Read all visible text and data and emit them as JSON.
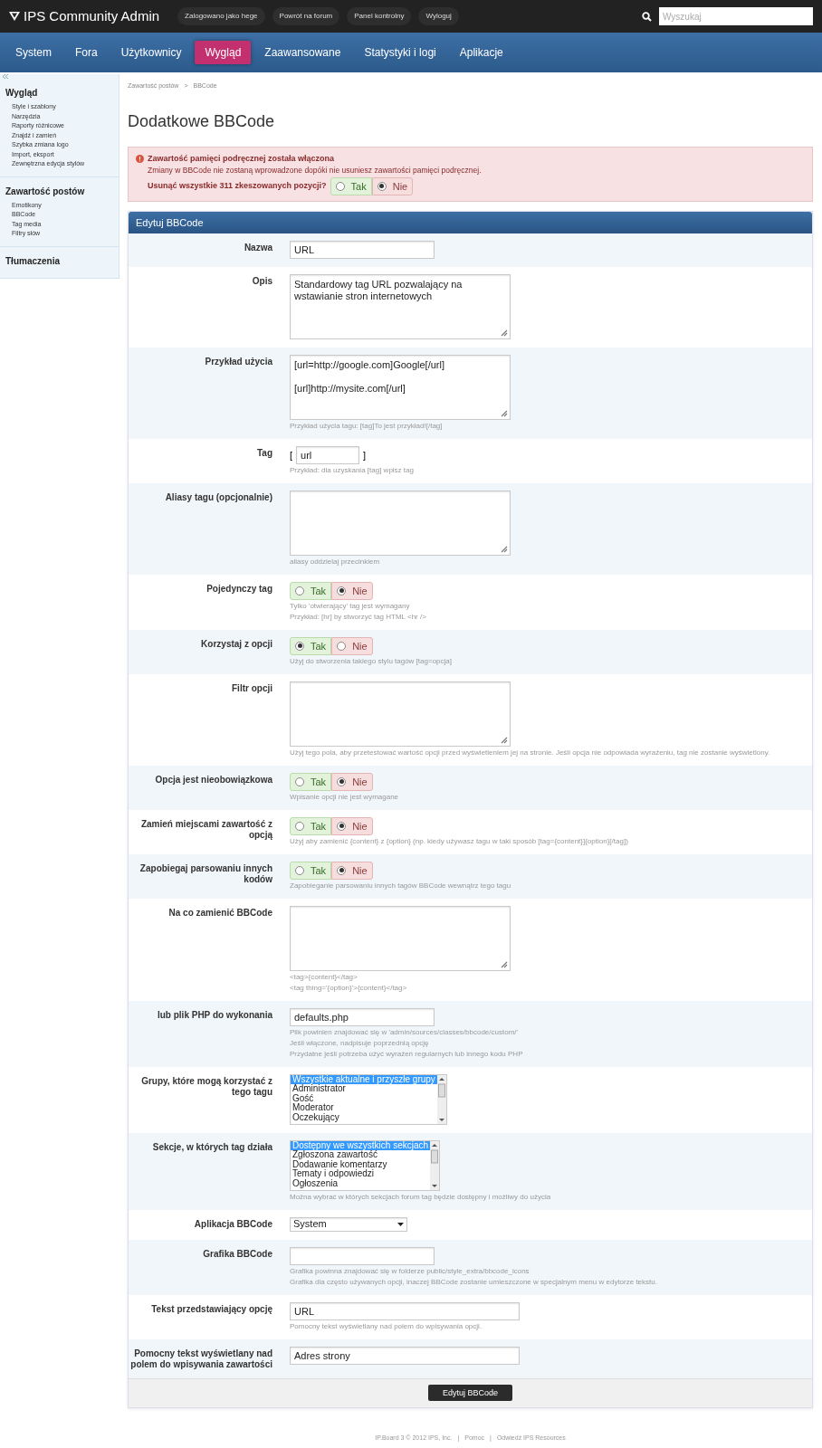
{
  "top_bar": {
    "logo": "IPS Community Admin",
    "links": [
      "Zalogowano jako hege",
      "Powrót na forum",
      "Panel kontrolny",
      "Wyloguj"
    ],
    "search": {
      "placeholder": "Wyszukaj"
    }
  },
  "nav": [
    {
      "label": "System",
      "selected": false
    },
    {
      "label": "Fora",
      "selected": false
    },
    {
      "label": "Użytkownicy",
      "selected": false
    },
    {
      "label": "Wygląd",
      "selected": true
    },
    {
      "label": "Zaawansowane",
      "selected": false
    },
    {
      "label": "Statystyki i logi",
      "selected": false
    },
    {
      "label": "Aplikacje",
      "selected": false
    }
  ],
  "sidebar": [
    {
      "title": "Wygląd",
      "items": [
        "Style i szablony",
        "Narzędzia",
        "Raporty różnicowe",
        "Znajdź i zamień",
        "Szybka zmiana logo",
        "Import, eksport",
        "Zewnętrzna edycja stylów"
      ]
    },
    {
      "title": "Zawartość postów",
      "items": [
        "Emotikony",
        "BBCode",
        "Tag media",
        "Filtry słów"
      ]
    },
    {
      "title": "Tłumaczenia"
    }
  ],
  "breadcrumb": [
    "Zawartość postów",
    ">",
    "BBCode"
  ],
  "page_title": "Dodatkowe BBCode",
  "alert": {
    "title": "Zawartość pamięci podręcznej została włączona",
    "message": "Zmiany w BBCode nie zostaną wprowadzone dopóki nie usuniesz zawartości pamięci podręcznej.",
    "question": "Usunąć wszystkie 311 zkeszowanych pozycji?",
    "options": [
      {
        "label": "Tak",
        "selected": false
      },
      {
        "label": "Nie",
        "selected": true
      }
    ]
  },
  "form": {
    "title": "Edytuj BBCode",
    "rows": [
      {
        "kind": "text",
        "label": "Nazwa",
        "value": "URL"
      },
      {
        "kind": "textarea",
        "label": "Opis",
        "value": "Standardowy tag URL pozwalający na wstawianie stron internetowych"
      },
      {
        "kind": "textarea",
        "label": "Przykład użycia",
        "lines": [
          "[url=http://google.com]Google[/url]",
          "[url]http://mysite.com[/url]"
        ],
        "hints": [
          "Przykład użycia tagu: [tag]To jest przykład![/tag]"
        ]
      },
      {
        "kind": "tag",
        "label": "Tag",
        "prefix": "[",
        "value": "url",
        "suffix": "]",
        "hints": [
          "Przykład: dla uzyskania [tag] wpisz tag"
        ]
      },
      {
        "kind": "textarea",
        "label": "Aliasy tagu (opcjonalnie)",
        "hints": [
          "aliasy oddzielaj przecinkiem"
        ]
      },
      {
        "kind": "radio",
        "label": "Pojedynczy tag",
        "options": [
          {
            "label": "Tak",
            "selected": false
          },
          {
            "label": "Nie",
            "selected": true
          }
        ],
        "hints": [
          "Tylko 'otwierający' tag jest wymagany",
          "Przykład: [hr] by stworzyć tag HTML <hr />"
        ]
      },
      {
        "kind": "radio",
        "label": "Korzystaj z opcji",
        "options": [
          {
            "label": "Tak",
            "selected": true
          },
          {
            "label": "Nie",
            "selected": false
          }
        ],
        "hints": [
          "Użyj do stworzenia takiego stylu tagów [tag=opcja]"
        ]
      },
      {
        "kind": "textarea",
        "label": "Filtr opcji",
        "hints": [
          "Użyj tego pola, aby przetestować wartość opcji przed wyświetleniem jej na stronie. Jeśli opcja nie odpowiada wyrażeniu, tag nie zostanie wyświetlony."
        ]
      },
      {
        "kind": "radio",
        "label": "Opcja jest nieobowiązkowa",
        "options": [
          {
            "label": "Tak",
            "selected": false
          },
          {
            "label": "Nie",
            "selected": true
          }
        ],
        "hints": [
          "Wpisanie opcji nie jest wymagane"
        ]
      },
      {
        "kind": "radio",
        "label": "Zamień miejscami zawartość z opcją",
        "options": [
          {
            "label": "Tak",
            "selected": false
          },
          {
            "label": "Nie",
            "selected": true
          }
        ],
        "hints": [
          "Użyj aby zamienić {content} z {option} (np. kiedy używasz tagu w taki sposób [tag={content}]{option}[/tag])"
        ]
      },
      {
        "kind": "radio",
        "label": "Zapobiegaj parsowaniu innych kodów",
        "options": [
          {
            "label": "Tak",
            "selected": false
          },
          {
            "label": "Nie",
            "selected": true
          }
        ],
        "hints": [
          "Zapobieganie parsowaniu innych tagów BBCode wewnątrz tego tagu"
        ]
      },
      {
        "kind": "textarea",
        "label": "Na co zamienić BBCode",
        "hints": [
          "<tag>{content}</tag>",
          "<tag thing='{option}'>{content}</tag>"
        ]
      },
      {
        "kind": "text",
        "label": "lub plik PHP do wykonania",
        "value": "defaults.php",
        "hints": [
          "Plik powinien znajdować się w 'admin/sources/classes/bbcode/custom/'",
          "Jeśli włączone, nadpisuje poprzednią opcję",
          "Przydatne jeśli potrzeba użyć wyrażeń regularnych lub innego kodu PHP"
        ]
      },
      {
        "kind": "listbox",
        "label": "Grupy, które mogą korzystać z tego tagu",
        "options": [
          {
            "label": "Wszystkie aktualne i przyszłe grupy",
            "selected": true
          },
          {
            "label": "Administrator",
            "selected": false
          },
          {
            "label": "Gość",
            "selected": false
          },
          {
            "label": "Moderator",
            "selected": false
          },
          {
            "label": "Oczekujący",
            "selected": false
          }
        ]
      },
      {
        "kind": "listbox",
        "label": "Sekcje, w których tag działa",
        "options": [
          {
            "label": "Dostępny we wszystkich sekcjach",
            "selected": true
          },
          {
            "label": "Zgłoszona zawartość",
            "selected": false
          },
          {
            "label": "Dodawanie komentarzy",
            "selected": false
          },
          {
            "label": "Tematy i odpowiedzi",
            "selected": false
          },
          {
            "label": "Ogłoszenia",
            "selected": false
          }
        ],
        "hints": [
          "Można wybrać w których sekcjach forum tag będzie dostępny i możliwy do użycia"
        ]
      },
      {
        "kind": "select",
        "label": "Aplikacja BBCode",
        "value": "System"
      },
      {
        "kind": "text",
        "label": "Grafika BBCode",
        "hints": [
          "Grafika powinna znajdować się w folderze public/style_extra/bbcode_icons",
          "Grafika dla często używanych opcji, inaczej BBCode zostanie umieszczone w specjalnym menu w edytorze tekstu."
        ]
      },
      {
        "kind": "wide",
        "label": "Tekst przedstawiający opcję",
        "value": "URL",
        "hints": [
          "Pomocny tekst wyświetlany nad polem do wpisywania opcji."
        ]
      },
      {
        "kind": "wide",
        "label": "Pomocny tekst wyświetlany nad polem do wpisywania zawartości",
        "value": "Adres strony"
      }
    ],
    "submit": "Edytuj BBCode"
  },
  "footer": [
    "IP.Board 3 © 2012 IPS, Inc.",
    "|",
    "Pomoc",
    "|",
    "Odwiedź IPS Resources"
  ]
}
